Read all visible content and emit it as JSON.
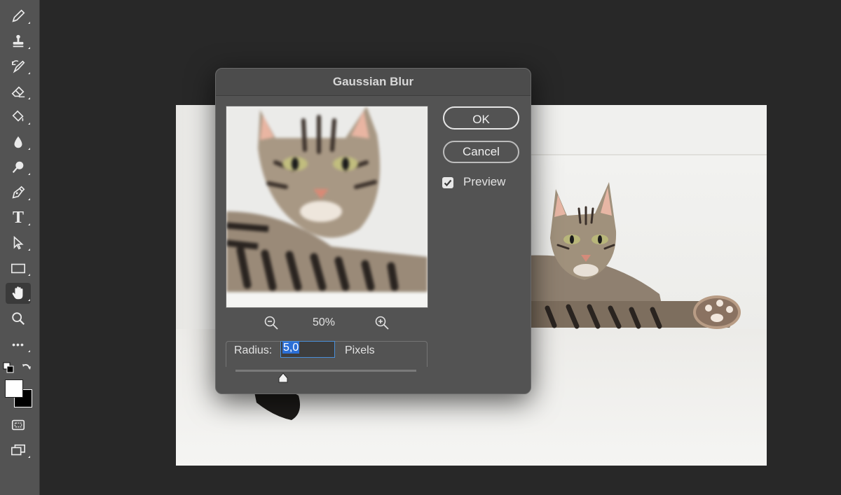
{
  "toolbar": {
    "tools": [
      {
        "icon": "brush-icon",
        "active": false
      },
      {
        "icon": "clone-stamp-icon",
        "active": false
      },
      {
        "icon": "history-brush-icon",
        "active": false
      },
      {
        "icon": "eraser-icon",
        "active": false
      },
      {
        "icon": "paint-bucket-icon",
        "active": false
      },
      {
        "icon": "blur-drop-icon",
        "active": false
      },
      {
        "icon": "dodge-icon",
        "active": false
      },
      {
        "icon": "pen-icon",
        "active": false
      },
      {
        "icon": "type-icon",
        "active": false
      },
      {
        "icon": "path-selection-icon",
        "active": false
      },
      {
        "icon": "rectangle-icon",
        "active": false
      },
      {
        "icon": "hand-icon",
        "active": true
      },
      {
        "icon": "zoom-icon",
        "active": false
      },
      {
        "icon": "more-tools-icon",
        "active": false
      }
    ],
    "type_tool_glyph": "T",
    "more_glyph": "•••",
    "foreground_color": "#ffffff",
    "background_color": "#000000"
  },
  "dialog": {
    "title": "Gaussian Blur",
    "ok_label": "OK",
    "cancel_label": "Cancel",
    "preview_label": "Preview",
    "preview_checked": true,
    "zoom_level": "50%",
    "radius_label": "Radius:",
    "radius_value": "5,0",
    "radius_unit": "Pixels"
  },
  "colors": {
    "app_background": "#282828",
    "toolbar": "#535353",
    "dialog": "#535353",
    "selection": "#2b6fd6"
  }
}
